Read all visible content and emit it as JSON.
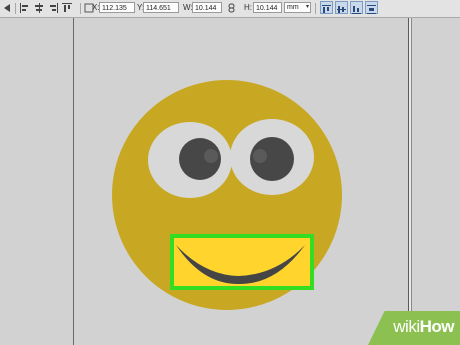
{
  "toolbar": {
    "x_label": "X:",
    "x_value": "112.135",
    "y_label": "Y:",
    "y_value": "114.651",
    "w_label": "W:",
    "w_value": "10.144",
    "h_label": "H:",
    "h_value": "10.144",
    "link_icon": "chain-link-icon",
    "unit_value": "mm",
    "align_buttons": [
      "align-top-icon",
      "align-vcenter-icon",
      "align-bottom-icon",
      "distribute-icon"
    ]
  },
  "canvas": {
    "face_color": "#c8a823",
    "eye_white_color": "#d8d8d8",
    "pupil_color": "#474747",
    "mouth_box_color": "#ffd52d",
    "selection_color": "#33dd22",
    "mouth_color": "#454545"
  },
  "watermark": {
    "part1": "wiki",
    "part2": "How"
  }
}
